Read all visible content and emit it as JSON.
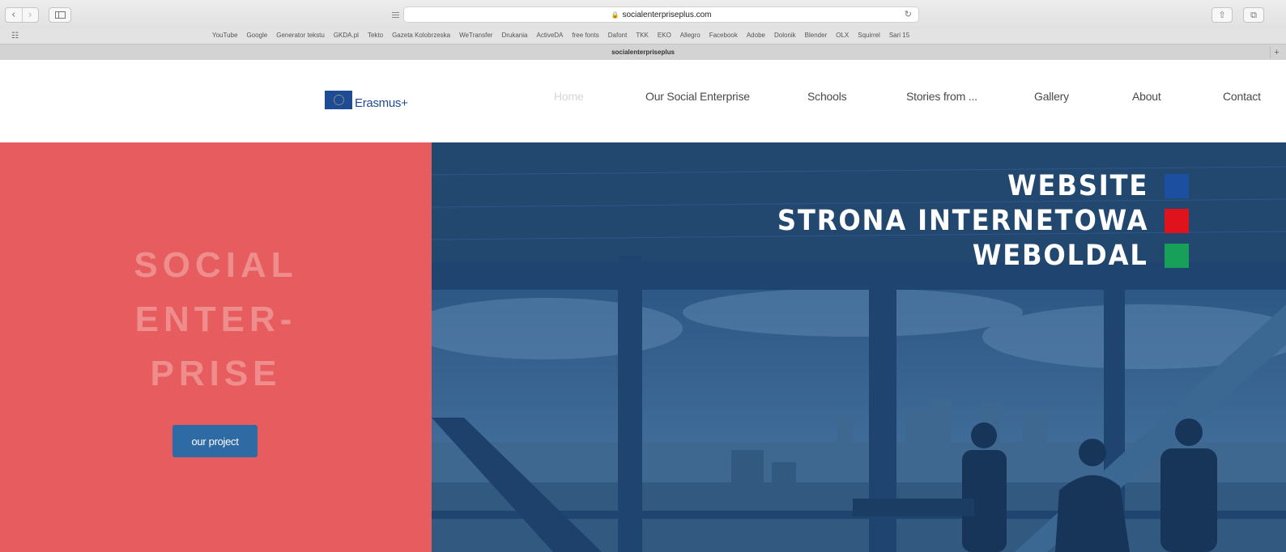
{
  "browser": {
    "url": "socialenterpriseplus.com",
    "tab_title": "socialenterpriseplus",
    "favorites": [
      "YouTube",
      "Google",
      "Generator tekstu",
      "GKDA.pl",
      "Tekto",
      "Gazeta Kolobrzeska",
      "WeTransfer",
      "Drukania",
      "ActiveDA",
      "free fonts",
      "Dafont",
      "TKK",
      "EKO",
      "Allegro",
      "Facebook",
      "Adobe",
      "Dolonik",
      "Blender",
      "OLX",
      "Squirrel",
      "Sari 15"
    ],
    "icons": {
      "back": "‹",
      "forward": "›",
      "reload": "↻",
      "share": "⇧",
      "tabs": "⧉",
      "grid": "☷",
      "lock": "🔒",
      "new_tab": "+"
    }
  },
  "site": {
    "logo_text": "Erasmus+",
    "nav": {
      "home": "Home",
      "enterprise": "Our Social Enterprise",
      "schools": "Schools",
      "stories": "Stories from ...",
      "gallery": "Gallery",
      "about": "About",
      "contact": "Contact"
    },
    "hero": {
      "line1": "SOCIAL",
      "line2": "ENTER-",
      "line3": "PRISE",
      "button": "our project"
    }
  },
  "overlay": {
    "labels": [
      {
        "text": "WEBSITE",
        "color": "#1d4fa0"
      },
      {
        "text": "STRONA INTERNETOWA",
        "color": "#e0121c"
      },
      {
        "text": "WEBOLDAL",
        "color": "#16a05a"
      }
    ]
  },
  "colors": {
    "hero_left": "#e75c5e",
    "hero_right": "#27517e",
    "button": "#2e6aa3"
  }
}
